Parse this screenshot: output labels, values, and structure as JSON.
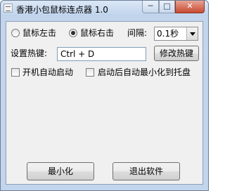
{
  "window": {
    "title": "香港小包鼠标连点器 1.0",
    "caption_min": "─",
    "caption_max": "□",
    "caption_close": "✕"
  },
  "click_mode": {
    "left_click_label": "鼠标左击",
    "right_click_label": "鼠标右击",
    "selected": "right"
  },
  "interval": {
    "label": "间隔:",
    "value": "0.1秒"
  },
  "hotkey": {
    "label": "设置热键:",
    "value": "Ctrl + D",
    "change_button_label": "修改热键"
  },
  "options": {
    "autostart_label": "开机自动启动",
    "autostart_checked": false,
    "minimize_to_tray_label": "启动后自动最小化到托盘",
    "minimize_to_tray_checked": false
  },
  "actions": {
    "minimize_label": "最小化",
    "exit_label": "退出软件"
  }
}
